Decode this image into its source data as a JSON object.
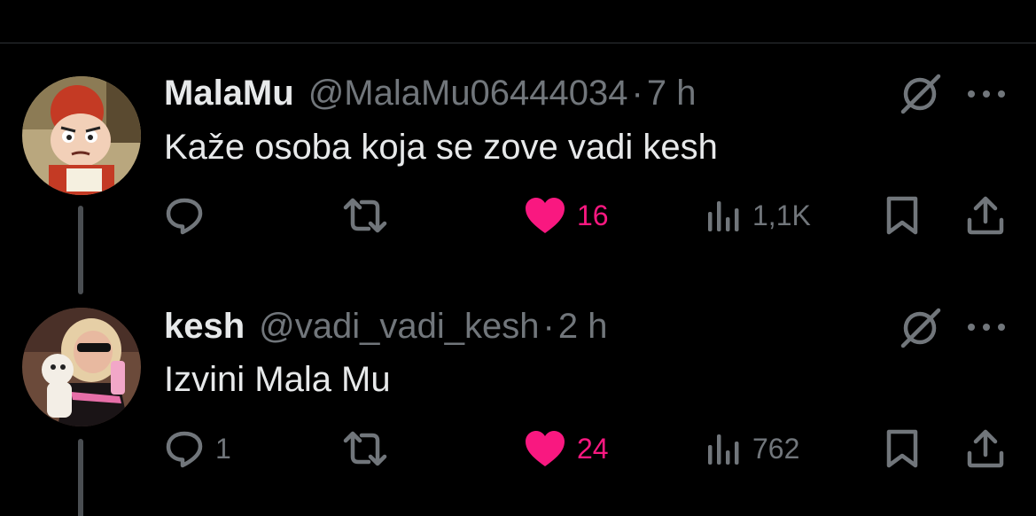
{
  "tweets": [
    {
      "name": "MalaMu",
      "handle": "@MalaMu06444034",
      "separator": "·",
      "time": "7 h",
      "text": "Kaže osoba koja se zove vadi kesh",
      "replies": "",
      "likes": "16",
      "views": "1,1K",
      "avatar_desc": "cartoon-girl-avatar"
    },
    {
      "name": "kesh",
      "handle": "@vadi_vadi_kesh",
      "separator": "·",
      "time": "2 h",
      "text": "Izvini Mala Mu",
      "replies": "1",
      "likes": "24",
      "views": "762",
      "avatar_desc": "woman-with-dog-avatar"
    }
  ],
  "colors": {
    "background": "#000000",
    "text": "#e7e9ea",
    "muted": "#71767b",
    "like": "#f91880",
    "thread_line": "#4a4e52"
  },
  "icons": [
    "reply-icon",
    "retweet-icon",
    "heart-icon",
    "views-icon",
    "bookmark-icon",
    "share-icon",
    "grok-icon",
    "more-icon"
  ]
}
